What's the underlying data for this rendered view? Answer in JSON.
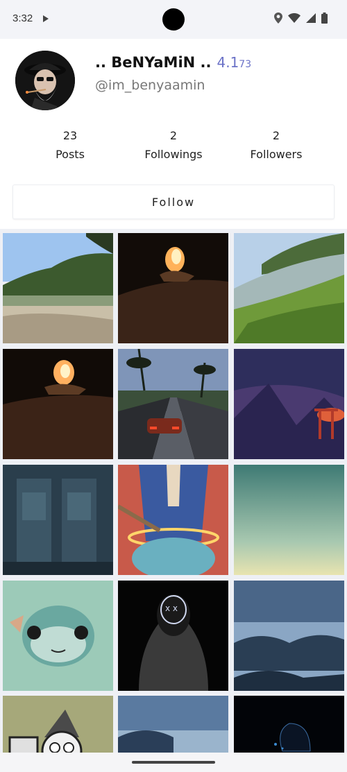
{
  "status_bar": {
    "time": "3:32",
    "icons": [
      "play-icon",
      "location-icon",
      "wifi-icon",
      "signal-icon",
      "battery-icon"
    ]
  },
  "profile": {
    "display_name": ".. BeNYaMiN ..",
    "score_main": "4.1",
    "score_sub": "73",
    "username": "@im_benyaamin",
    "stats": {
      "posts": {
        "count": "23",
        "label": "Posts"
      },
      "followings": {
        "count": "2",
        "label": "Followings"
      },
      "followers": {
        "count": "2",
        "label": "Followers"
      }
    },
    "follow_label": "Follow",
    "accent_color": "#6b72c7"
  },
  "posts": [
    {
      "subject": "hills-and-lake-photo"
    },
    {
      "subject": "campfire-at-night-photo"
    },
    {
      "subject": "river-and-grass-photo"
    },
    {
      "subject": "campfire-closeup-photo"
    },
    {
      "subject": "sports-car-palm-road-photo"
    },
    {
      "subject": "purple-mountain-torii-art"
    },
    {
      "subject": "denim-pockets-photo"
    },
    {
      "subject": "anime-halo-illustration"
    },
    {
      "subject": "teal-sky-horizon-photo"
    },
    {
      "subject": "pufferfish-photo"
    },
    {
      "subject": "neon-mask-hoodie-art"
    },
    {
      "subject": "blue-rocky-sea-photo"
    },
    {
      "subject": "cartoon-sewing-machine-art"
    },
    {
      "subject": "stormy-blue-sea-photo"
    },
    {
      "subject": "dark-night-creature-art"
    }
  ]
}
